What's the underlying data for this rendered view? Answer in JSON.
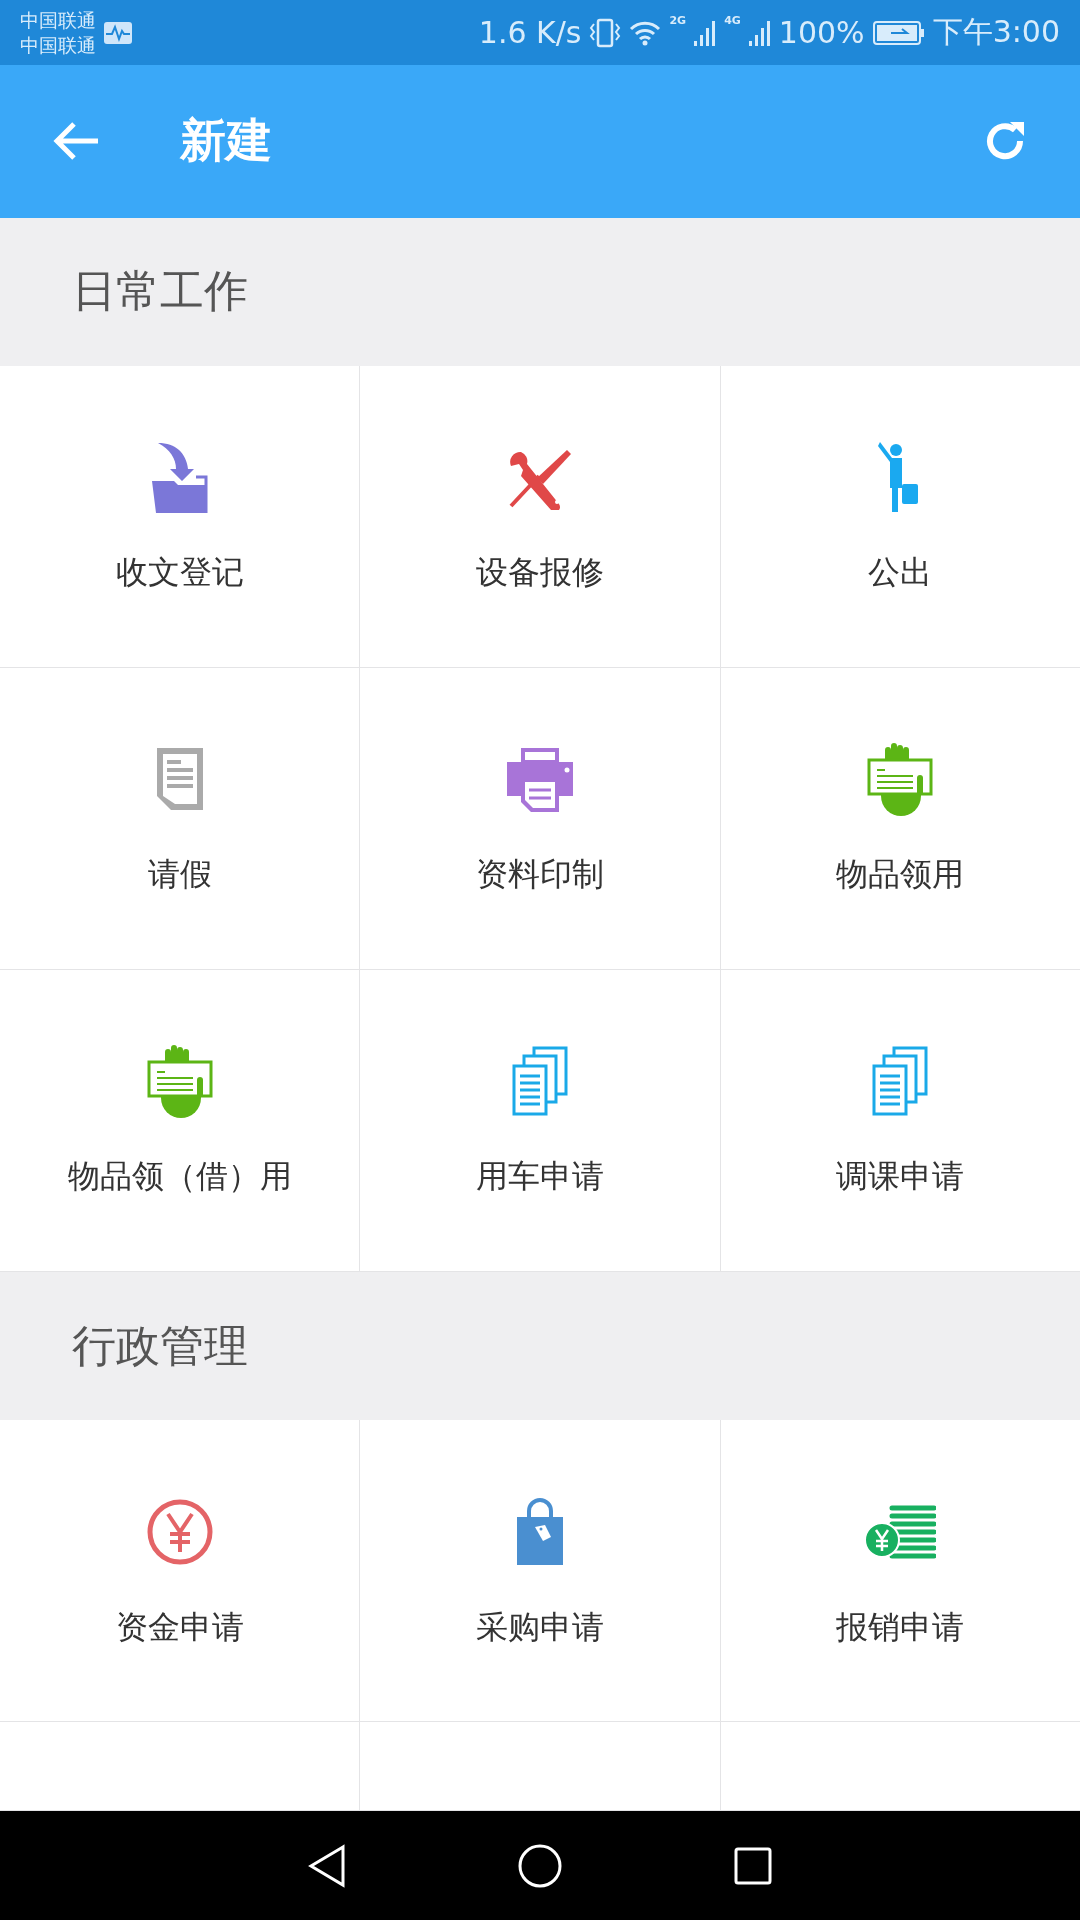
{
  "status_bar": {
    "carriers": [
      "中国联通",
      "中国联通"
    ],
    "speed": "1.6 K/s",
    "network_labels": [
      "2G",
      "4G"
    ],
    "battery": "100%",
    "time": "下午3:00"
  },
  "app_bar": {
    "title": "新建"
  },
  "sections": [
    {
      "title": "日常工作",
      "items": [
        {
          "label": "收文登记",
          "kind": "folder"
        },
        {
          "label": "设备报修",
          "kind": "tools"
        },
        {
          "label": "公出",
          "kind": "traveler"
        },
        {
          "label": "请假",
          "kind": "document"
        },
        {
          "label": "资料印制",
          "kind": "printer"
        },
        {
          "label": "物品领用",
          "kind": "hand"
        },
        {
          "label": "物品领（借）用",
          "kind": "hand"
        },
        {
          "label": "用车申请",
          "kind": "pages"
        },
        {
          "label": "调课申请",
          "kind": "pages"
        }
      ]
    },
    {
      "title": "行政管理",
      "items": [
        {
          "label": "资金申请",
          "kind": "yen"
        },
        {
          "label": "采购申请",
          "kind": "bag"
        },
        {
          "label": "报销申请",
          "kind": "coins"
        }
      ]
    }
  ]
}
